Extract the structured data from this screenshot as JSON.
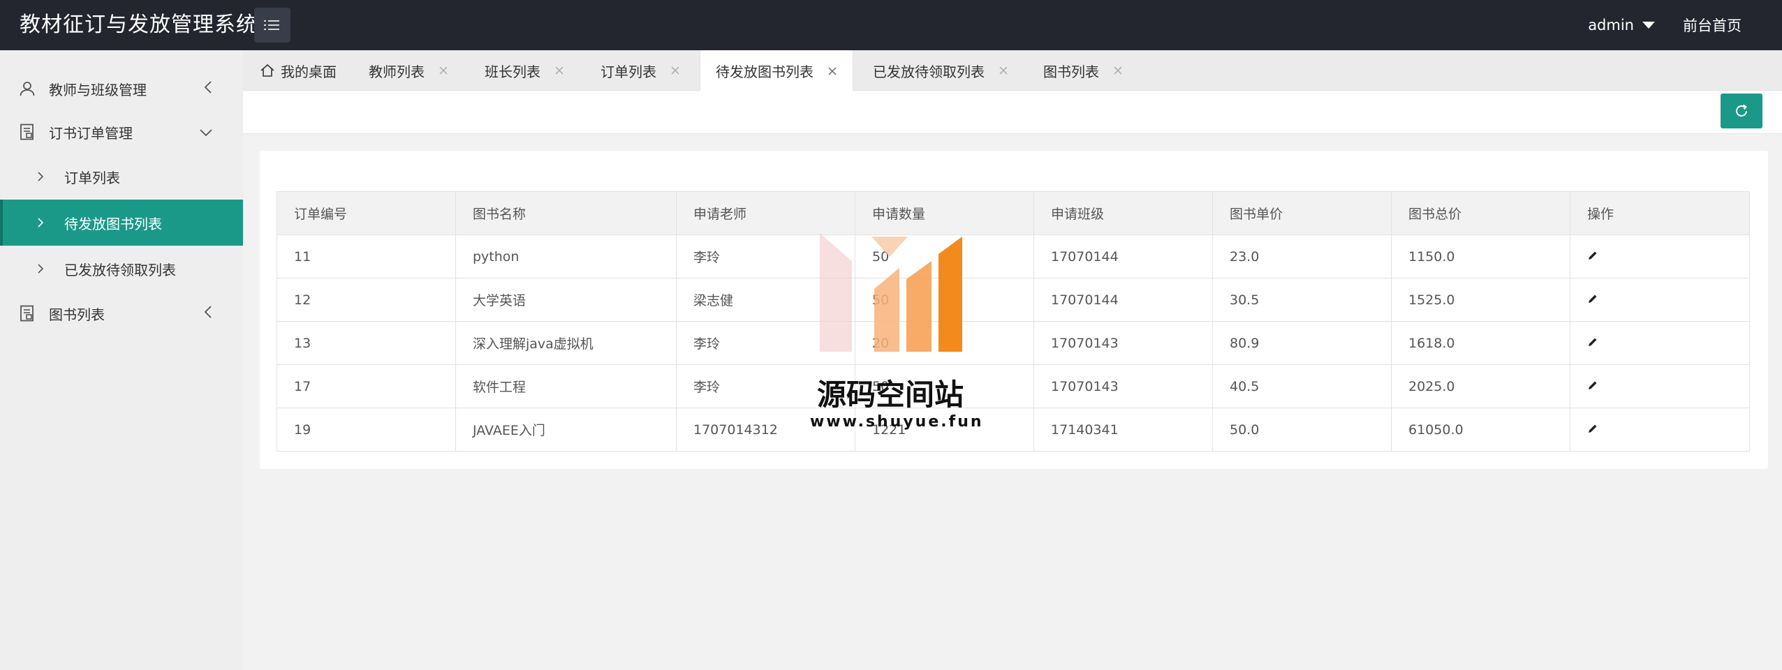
{
  "header": {
    "title": "教材征订与发放管理系统",
    "user": "admin",
    "home_link": "前台首页"
  },
  "sidebar": {
    "groups": [
      {
        "label": "教师与班级管理",
        "icon": "user-icon"
      },
      {
        "label": "订书订单管理",
        "icon": "document-icon"
      },
      {
        "label": "图书列表",
        "icon": "document-icon"
      }
    ],
    "subitems": [
      {
        "label": "订单列表"
      },
      {
        "label": "待发放图书列表"
      },
      {
        "label": "已发放待领取列表"
      }
    ]
  },
  "tabs": [
    {
      "label": "我的桌面"
    },
    {
      "label": "教师列表"
    },
    {
      "label": "班长列表"
    },
    {
      "label": "订单列表"
    },
    {
      "label": "待发放图书列表"
    },
    {
      "label": "已发放待领取列表"
    },
    {
      "label": "图书列表"
    }
  ],
  "table": {
    "columns": [
      "订单编号",
      "图书名称",
      "申请老师",
      "申请数量",
      "申请班级",
      "图书单价",
      "图书总价",
      "操作"
    ],
    "rows": [
      [
        "11",
        "python",
        "李玲",
        "50",
        "17070144",
        "23.0",
        "1150.0"
      ],
      [
        "12",
        "大学英语",
        "梁志健",
        "50",
        "17070144",
        "30.5",
        "1525.0"
      ],
      [
        "13",
        "深入理解java虚拟机",
        "李玲",
        "20",
        "17070143",
        "80.9",
        "1618.0"
      ],
      [
        "17",
        "软件工程",
        "李玲",
        "50",
        "17070143",
        "40.5",
        "2025.0"
      ],
      [
        "19",
        "JAVAEE入门",
        "1707014312",
        "1221",
        "17140341",
        "50.0",
        "61050.0"
      ]
    ]
  },
  "watermark": {
    "text": "源码空间站",
    "url": "www.shuyue.fun"
  },
  "colors": {
    "accent": "#1a9988",
    "header_bg": "#23262e",
    "sidebar_bg": "#eeeeee"
  }
}
